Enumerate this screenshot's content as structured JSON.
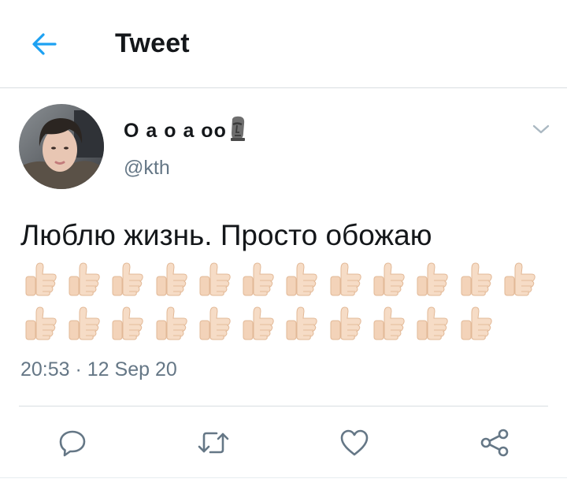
{
  "header": {
    "title": "Tweet",
    "back_icon": "arrow-left-icon",
    "accent_color": "#1da1f2"
  },
  "tweet": {
    "author": {
      "display_name": "О а о а оо",
      "name_emoji": "moai-emoji",
      "handle": "@kth",
      "avatar": "user-avatar-photo"
    },
    "text": "Люблю жизнь. Просто обожаю",
    "emoji": {
      "name": "thumbs-up-emoji",
      "rows": [
        12,
        11
      ]
    },
    "timestamp": "20:53 · 12 Sep 20",
    "menu_icon": "chevron-down-icon"
  },
  "actions": [
    {
      "name": "reply",
      "icon": "reply-icon"
    },
    {
      "name": "retweet",
      "icon": "retweet-icon"
    },
    {
      "name": "like",
      "icon": "heart-icon"
    },
    {
      "name": "share",
      "icon": "share-icon"
    }
  ]
}
